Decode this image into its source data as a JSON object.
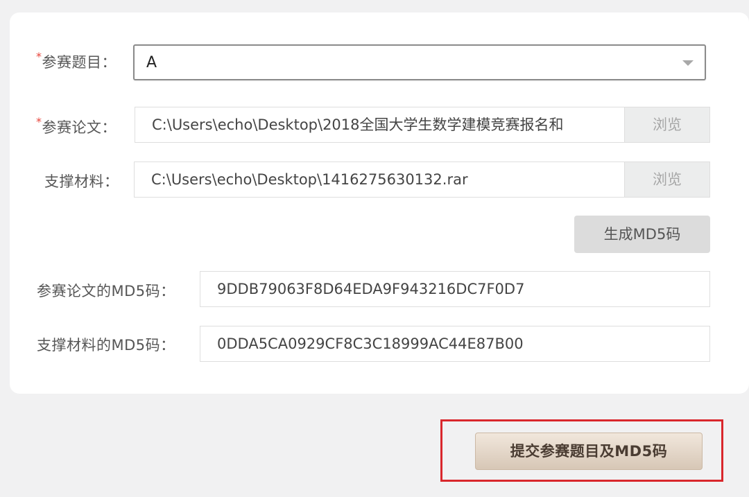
{
  "form": {
    "topic": {
      "required_mark": "*",
      "label": "参赛题目：",
      "value": "A"
    },
    "paper": {
      "required_mark": "*",
      "label": "参赛论文：",
      "value": "C:\\Users\\echo\\Desktop\\2018全国大学生数学建模竞赛报名和",
      "browse_label": "浏览"
    },
    "material": {
      "label": "支撑材料：",
      "value": "C:\\Users\\echo\\Desktop\\1416275630132.rar",
      "browse_label": "浏览"
    },
    "generate_md5_label": "生成MD5码",
    "paper_md5": {
      "label": "参赛论文的MD5码：",
      "value": "9DDB79063F8D64EDA9F943216DC7F0D7"
    },
    "material_md5": {
      "label": "支撑材料的MD5码：",
      "value": "0DDA5CA0929CF8C3C18999AC44E87B00"
    }
  },
  "submit_label": "提交参赛题目及MD5码",
  "colors": {
    "required": "#e8443a",
    "highlight": "#d9272c",
    "submit_button": "#e3d5c6"
  }
}
